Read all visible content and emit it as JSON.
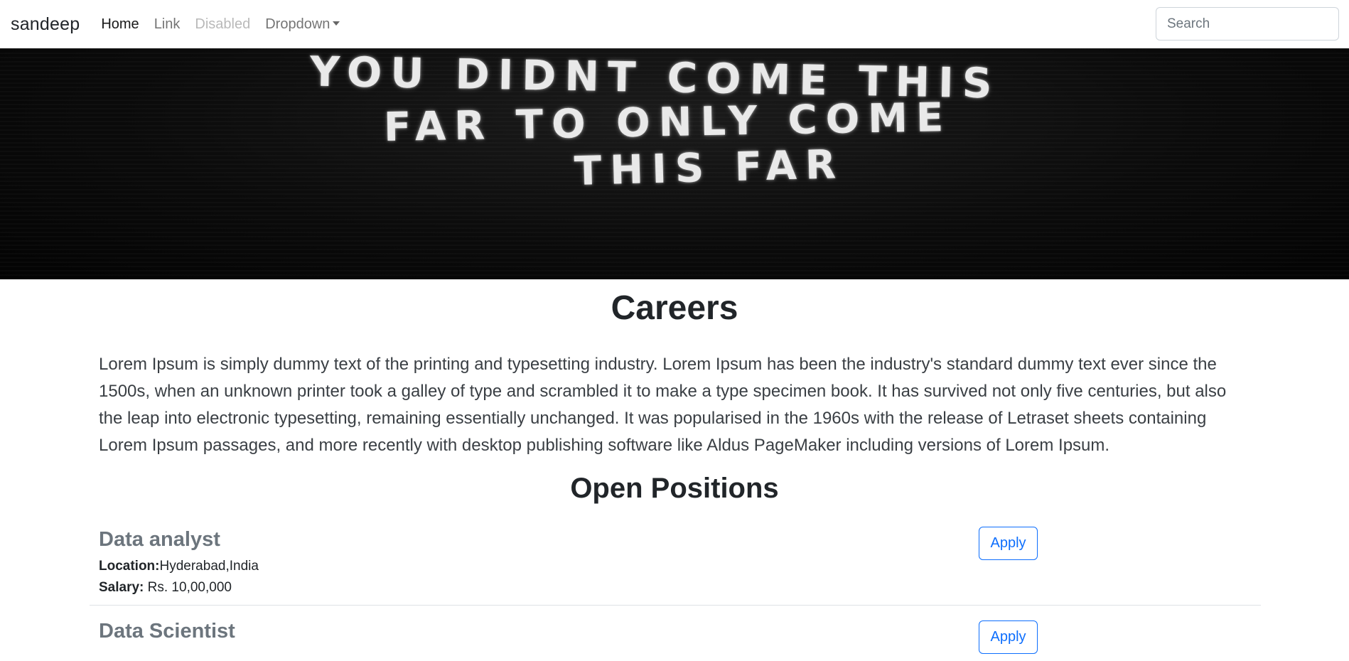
{
  "navbar": {
    "brand": "sandeep",
    "links": [
      {
        "label": "Home"
      },
      {
        "label": "Link"
      },
      {
        "label": "Disabled"
      },
      {
        "label": "Dropdown"
      }
    ],
    "search_placeholder": "Search"
  },
  "hero": {
    "lines": [
      "YOU DIDNT COME THIS",
      "FAR TO ONLY COME",
      "THIS FAR"
    ]
  },
  "main": {
    "title": "Careers",
    "lead": "Lorem Ipsum is simply dummy text of the printing and typesetting industry. Lorem Ipsum has been the industry's standard dummy text ever since the 1500s, when an unknown printer took a galley of type and scrambled it to make a type specimen book. It has survived not only five centuries, but also the leap into electronic typesetting, remaining essentially unchanged. It was popularised in the 1960s with the release of Letraset sheets containing Lorem Ipsum passages, and more recently with desktop publishing software like Aldus PageMaker including versions of Lorem Ipsum.",
    "positions_heading": "Open Positions",
    "positions": [
      {
        "title": "Data analyst",
        "location_label": "Location:",
        "location": "Hyderabad,India",
        "salary_label": "Salary:",
        "salary": "Rs. 10,00,000",
        "apply_label": "Apply"
      },
      {
        "title": "Data Scientist",
        "apply_label": "Apply"
      }
    ]
  },
  "colors": {
    "accent": "#0d6efd",
    "muted_title": "#6c757d",
    "hero_bg": "#0b0b0b"
  }
}
